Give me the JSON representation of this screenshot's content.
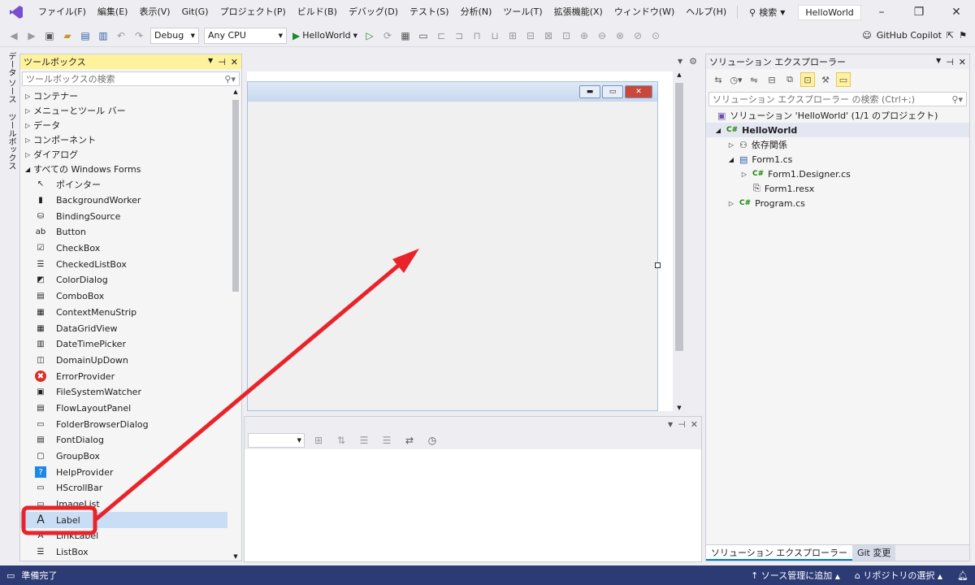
{
  "menu": {
    "items": [
      "ファイル(F)",
      "編集(E)",
      "表示(V)",
      "Git(G)",
      "プロジェクト(P)",
      "ビルド(B)",
      "デバッグ(D)",
      "テスト(S)",
      "分析(N)",
      "ツール(T)",
      "拡張機能(X)",
      "ウィンドウ(W)",
      "ヘルプ(H)"
    ],
    "search_label": "検索",
    "solution_name": "HelloWorld"
  },
  "toolbar": {
    "config": "Debug",
    "platform": "Any CPU",
    "run_target": "HelloWorld",
    "copilot": "GitHub Copilot"
  },
  "side_tabs": [
    "データ ソース",
    "ツールボックス"
  ],
  "toolbox": {
    "title": "ツールボックス",
    "search_placeholder": "ツールボックスの検索",
    "categories": [
      "コンテナー",
      "メニューとツール バー",
      "データ",
      "コンポーネント",
      "ダイアログ",
      "すべての Windows Forms"
    ],
    "items": [
      {
        "label": "ポインター",
        "icon": "pointer-icon",
        "glyph": "↖"
      },
      {
        "label": "BackgroundWorker",
        "icon": "backgroundworker-icon",
        "glyph": "▮"
      },
      {
        "label": "BindingSource",
        "icon": "bindingsource-icon",
        "glyph": "⛁"
      },
      {
        "label": "Button",
        "icon": "button-icon",
        "glyph": "ab"
      },
      {
        "label": "CheckBox",
        "icon": "checkbox-icon",
        "glyph": "☑"
      },
      {
        "label": "CheckedListBox",
        "icon": "checkedlistbox-icon",
        "glyph": "☰"
      },
      {
        "label": "ColorDialog",
        "icon": "colordialog-icon",
        "glyph": "◩"
      },
      {
        "label": "ComboBox",
        "icon": "combobox-icon",
        "glyph": "▤"
      },
      {
        "label": "ContextMenuStrip",
        "icon": "contextmenustrip-icon",
        "glyph": "▦"
      },
      {
        "label": "DataGridView",
        "icon": "datagridview-icon",
        "glyph": "▦"
      },
      {
        "label": "DateTimePicker",
        "icon": "datetimepicker-icon",
        "glyph": "▥"
      },
      {
        "label": "DomainUpDown",
        "icon": "domainupdown-icon",
        "glyph": "◫"
      },
      {
        "label": "ErrorProvider",
        "icon": "errorprovider-icon",
        "glyph": "✖"
      },
      {
        "label": "FileSystemWatcher",
        "icon": "filesystemwatcher-icon",
        "glyph": "▣"
      },
      {
        "label": "FlowLayoutPanel",
        "icon": "flowlayoutpanel-icon",
        "glyph": "▤"
      },
      {
        "label": "FolderBrowserDialog",
        "icon": "folderbrowserdialog-icon",
        "glyph": "▭"
      },
      {
        "label": "FontDialog",
        "icon": "fontdialog-icon",
        "glyph": "▤"
      },
      {
        "label": "GroupBox",
        "icon": "groupbox-icon",
        "glyph": "▢"
      },
      {
        "label": "HelpProvider",
        "icon": "helpprovider-icon",
        "glyph": "?"
      },
      {
        "label": "HScrollBar",
        "icon": "hscrollbar-icon",
        "glyph": "▭"
      },
      {
        "label": "ImageList",
        "icon": "imagelist-icon",
        "glyph": "▭"
      },
      {
        "label": "Label",
        "icon": "label-icon",
        "glyph": "A"
      },
      {
        "label": "LinkLabel",
        "icon": "linklabel-icon",
        "glyph": "A"
      },
      {
        "label": "ListBox",
        "icon": "listbox-icon",
        "glyph": "☰"
      }
    ],
    "selected": "Label"
  },
  "solution_explorer": {
    "title": "ソリューション エクスプローラー",
    "search_placeholder": "ソリューション エクスプローラー の検索 (Ctrl+;)",
    "solution": "ソリューション 'HelloWorld' (1/1 のプロジェクト)",
    "project": "HelloWorld",
    "dependencies": "依存関係",
    "form": "Form1.cs",
    "designer_file": "Form1.Designer.cs",
    "resx": "Form1.resx",
    "program": "Program.cs",
    "tabs": [
      "ソリューション エクスプローラー",
      "Git 変更"
    ]
  },
  "status": {
    "left": "準備完了",
    "source_control": "ソース管理に追加",
    "repository": "リポジトリの選択"
  },
  "colors": {
    "accent": "#2d3b75",
    "highlight": "#e8232a",
    "toolbox_title": "#fff29d"
  }
}
